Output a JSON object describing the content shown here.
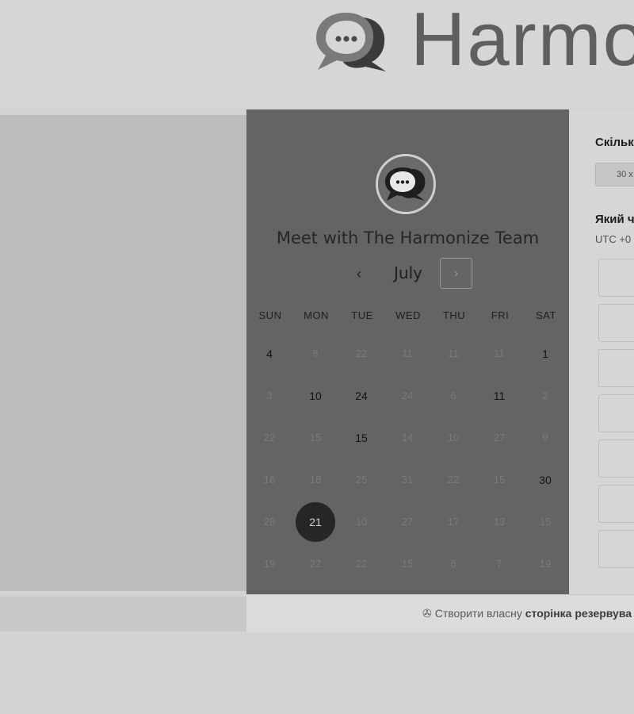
{
  "header": {
    "brand_text": "Harmo",
    "logo_icon": "chat-bubble-logo-icon"
  },
  "calendar": {
    "title": "Meet with The Harmonize Team",
    "month": "July",
    "prev_icon": "‹",
    "next_icon": "›",
    "weekdays": [
      "SUN",
      "MON",
      "TUE",
      "WED",
      "THU",
      "FRI",
      "SAT"
    ],
    "weeks": [
      [
        {
          "d": "4",
          "a": true
        },
        {
          "d": "8"
        },
        {
          "d": "22"
        },
        {
          "d": "11"
        },
        {
          "d": "11"
        },
        {
          "d": "11"
        },
        {
          "d": "1",
          "a": true
        }
      ],
      [
        {
          "d": "3"
        },
        {
          "d": "10",
          "a": true
        },
        {
          "d": "24",
          "a": true
        },
        {
          "d": "24"
        },
        {
          "d": "6"
        },
        {
          "d": "11",
          "a": true
        },
        {
          "d": "2"
        }
      ],
      [
        {
          "d": "22"
        },
        {
          "d": "15"
        },
        {
          "d": "15",
          "a": true
        },
        {
          "d": "14"
        },
        {
          "d": "10"
        },
        {
          "d": "27"
        },
        {
          "d": "9"
        }
      ],
      [
        {
          "d": "16"
        },
        {
          "d": "18"
        },
        {
          "d": "25"
        },
        {
          "d": "31"
        },
        {
          "d": "22"
        },
        {
          "d": "15"
        },
        {
          "d": "30",
          "a": true
        }
      ],
      [
        {
          "d": "28"
        },
        {
          "d": "21",
          "a": true,
          "s": true
        },
        {
          "d": "10"
        },
        {
          "d": "27"
        },
        {
          "d": "17"
        },
        {
          "d": "13"
        },
        {
          "d": "15"
        }
      ],
      [
        {
          "d": "19"
        },
        {
          "d": "22"
        },
        {
          "d": "22"
        },
        {
          "d": "15"
        },
        {
          "d": "6"
        },
        {
          "d": "7"
        },
        {
          "d": "19"
        }
      ]
    ],
    "selected_day": "21"
  },
  "booking": {
    "duration_question": "Скільк",
    "duration_value": "30 х",
    "time_question": "Який ч",
    "timezone": "UTC +0",
    "slots": [
      "",
      "",
      "",
      "",
      "",
      "",
      ""
    ]
  },
  "footer": {
    "prefix": "Створити власну ",
    "bold": "сторінка резервува",
    "icon": "hubspot-sprocket-icon"
  }
}
